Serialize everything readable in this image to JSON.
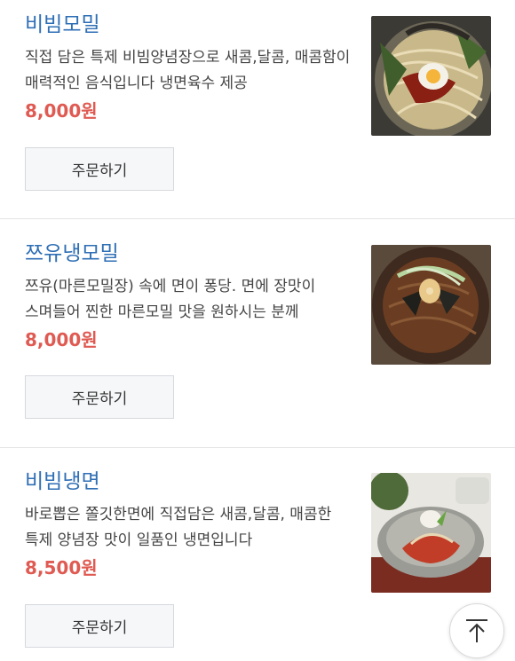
{
  "menu": {
    "items": [
      {
        "name": "비빔모밀",
        "description": "직접 담은 특제 비빔양념장으로 새콤,달콤, 매콤함이 매력적인 음식입니다 냉면육수 제공",
        "price": "8,000원",
        "order_label": "주문하기",
        "image_alt": "비빔모밀 사진"
      },
      {
        "name": "쯔유냉모밀",
        "description": "쯔유(마른모밀장) 속에 면이 퐁당. 면에 장맛이 스며들어 찐한 마른모밀 맛을 원하시는 분께",
        "price": "8,000원",
        "order_label": "주문하기",
        "image_alt": "쯔유냉모밀 사진"
      },
      {
        "name": "비빔냉면",
        "description": "바로뽑은 쫄깃한면에 직접담은 새콤,달콤, 매콤한 특제 양념장 맛이 일품인 냉면입니다",
        "price": "8,500원",
        "order_label": "주문하기",
        "image_alt": "비빔냉면 사진"
      }
    ]
  },
  "scroll_top": {
    "icon": "arrow-up-to-top-icon"
  },
  "colors": {
    "name": "#2f6fb5",
    "price": "#df5a52",
    "button_bg": "#f6f7f9"
  }
}
